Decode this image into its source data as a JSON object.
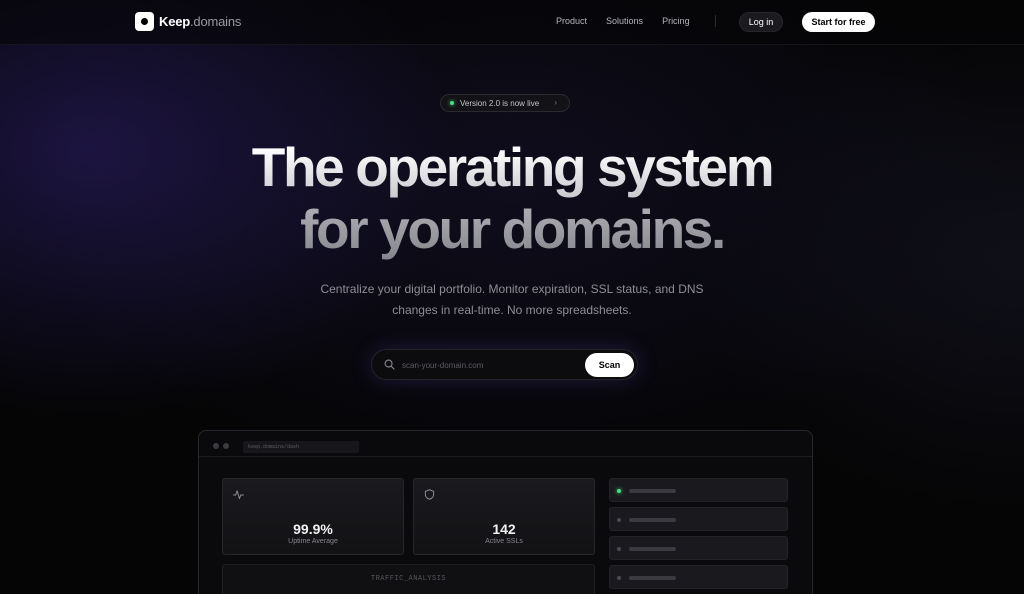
{
  "brand": {
    "name": "Keep",
    "suffix": ".domains"
  },
  "nav": {
    "links": [
      "Product",
      "Solutions",
      "Pricing"
    ],
    "login_label": "Log in",
    "cta_label": "Start for free"
  },
  "hero": {
    "badge": "Version 2.0 is now live",
    "headline_line1": "The operating system",
    "headline_line2": "for your domains.",
    "subtitle": "Centralize your digital portfolio. Monitor expiration, SSL status, and DNS changes in real-time. No more spreadsheets."
  },
  "search": {
    "placeholder": "scan-your-domain.com",
    "value": "",
    "button_label": "Scan"
  },
  "dashboard": {
    "url": "keep.domains/dash",
    "stats": [
      {
        "value": "99.9%",
        "label": "Uptime Average",
        "icon": "activity-icon"
      },
      {
        "value": "142",
        "label": "Active SSLs",
        "icon": "shield-icon"
      }
    ],
    "traffic_label": "TRAFFIC_ANALYSIS",
    "list_rows": [
      {
        "status": "ok"
      },
      {
        "status": "idle"
      },
      {
        "status": "idle"
      },
      {
        "status": "idle"
      }
    ]
  },
  "colors": {
    "accent_glow": "#6e5adc",
    "status_ok": "#4ade80",
    "background": "#050506"
  }
}
